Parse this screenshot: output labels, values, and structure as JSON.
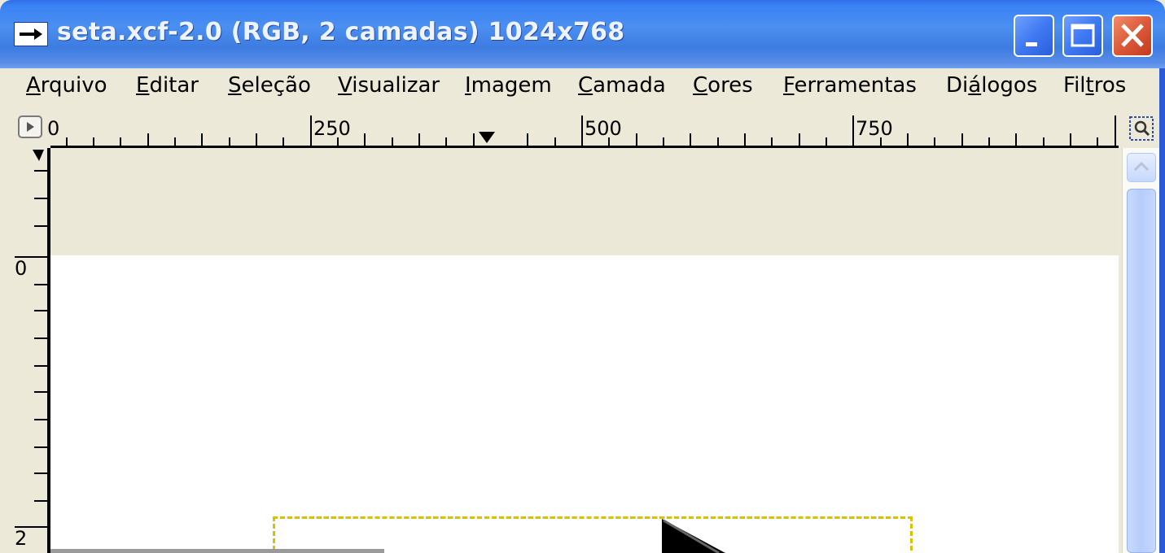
{
  "window": {
    "title": "seta.xcf-2.0 (RGB, 2 camadas) 1024x768"
  },
  "menu": {
    "items": [
      {
        "id": "arquivo",
        "accel": "A",
        "rest": "rquivo"
      },
      {
        "id": "editar",
        "accel": "E",
        "rest": "ditar"
      },
      {
        "id": "selecao",
        "accel": "S",
        "rest": "eleção"
      },
      {
        "id": "visualizar",
        "accel": "V",
        "rest": "isualizar"
      },
      {
        "id": "imagem",
        "accel": "I",
        "rest": "magem"
      },
      {
        "id": "camada",
        "accel": "C",
        "rest": "amada"
      },
      {
        "id": "cores",
        "accel": "C",
        "rest": "ores"
      },
      {
        "id": "ferramentas",
        "accel": "F",
        "rest": "erramentas"
      },
      {
        "id": "dialogos",
        "pre": "Di",
        "accel": "á",
        "rest": "logos"
      },
      {
        "id": "filtros",
        "pre": "Fil",
        "accel": "t",
        "rest": "ros"
      }
    ]
  },
  "rulers": {
    "horizontal": [
      "0",
      "250",
      "500",
      "750"
    ],
    "vertical": [
      "0",
      "2"
    ]
  },
  "colors": {
    "titlebar": "#3d7be0",
    "menubar": "#ece9d8",
    "canvas_bg": "#ebe8d8",
    "image": "#ffffff",
    "selection_yellow": "#ffe600"
  }
}
